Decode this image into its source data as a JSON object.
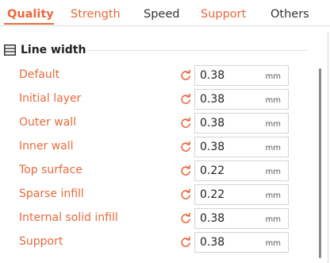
{
  "tabs": [
    {
      "label": "Quality",
      "active": true
    },
    {
      "label": "Strength",
      "active": false
    },
    {
      "label": "Speed",
      "active": false
    },
    {
      "label": "Support",
      "active": false
    },
    {
      "label": "Others",
      "active": false
    }
  ],
  "section": {
    "title": "Line width",
    "icon": "line-width-icon"
  },
  "rows": [
    {
      "label": "Default",
      "value": "0.38",
      "unit": "mm"
    },
    {
      "label": "Initial layer",
      "value": "0.38",
      "unit": "mm"
    },
    {
      "label": "Outer wall",
      "value": "0.38",
      "unit": "mm"
    },
    {
      "label": "Inner wall",
      "value": "0.38",
      "unit": "mm"
    },
    {
      "label": "Top surface",
      "value": "0.22",
      "unit": "mm"
    },
    {
      "label": "Sparse infill",
      "value": "0.22",
      "unit": "mm"
    },
    {
      "label": "Internal solid infill",
      "value": "0.38",
      "unit": "mm"
    },
    {
      "label": "Support",
      "value": "0.38",
      "unit": "mm"
    }
  ],
  "colors": {
    "accent": "#e8693c",
    "text": "#222222",
    "tab_inactive": "#333333",
    "border": "#d4d4d4"
  }
}
